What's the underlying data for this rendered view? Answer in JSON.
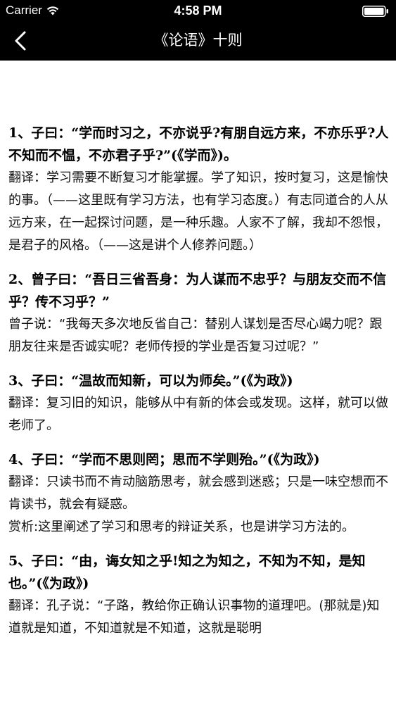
{
  "status_bar": {
    "carrier": "Carrier",
    "time": "4:58 PM",
    "wifi_icon": "wifi-icon",
    "battery_icon": "battery-full-icon"
  },
  "nav": {
    "title": "《论语》十则",
    "back_icon": "chevron-left-icon"
  },
  "entries": [
    {
      "heading": "1、子曰：“学而时习之，不亦说乎?有朋自远方来，不亦乐乎?人不知而不愠，不亦君子乎?”(《学而》)。",
      "lines": [
        "翻译：学习需要不断复习才能掌握。学了知识，按时复习，这是愉快的事。（——这里既有学习方法，也有学习态度。）有志同道合的人从远方来，在一起探讨问题，是一种乐趣。人家不了解，我却不怨恨，是君子的风格。（——这是讲个人修养问题。）"
      ]
    },
    {
      "heading": "2、曾子曰：“吾日三省吾身：为人谋而不忠乎？与朋友交而不信乎？传不习乎？”",
      "lines": [
        "曾子说：“我每天多次地反省自己：替别人谋划是否尽心竭力呢？跟朋友往来是否诚实呢？老师传授的学业是否复习过呢？”"
      ]
    },
    {
      "heading": "3、子曰：“温故而知新，可以为师矣。”(《为政》)",
      "lines": [
        "翻译：复习旧的知识，能够从中有新的体会或发现。这样，就可以做老师了。"
      ]
    },
    {
      "heading": "4、子曰：“学而不思则罔；思而不学则殆。”(《为政》)",
      "lines": [
        "翻译：只读书而不肯动脑筋思考，就会感到迷惑；只是一味空想而不肯读书，就会有疑惑。",
        "赏析:这里阐述了学习和思考的辩证关系，也是讲学习方法的。"
      ]
    },
    {
      "heading": "5、子曰：“由，诲女知之乎!知之为知之，不知为不知，是知也。”(《为政》)",
      "lines": [
        "翻译：孔子说：“子路，教给你正确认识事物的道理吧。(那就是)知道就是知道，不知道就是不知道，这就是聪明"
      ]
    }
  ]
}
